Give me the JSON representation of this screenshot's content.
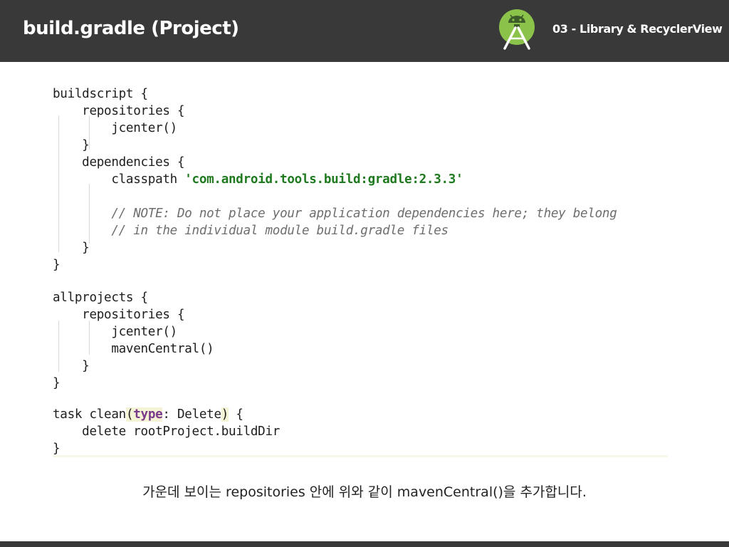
{
  "header": {
    "title": "build.gradle (Project)",
    "subtitle": "03 - Library & RecyclerView",
    "background_color": "#393939",
    "logo_icon": "android-studio-icon"
  },
  "code": {
    "lines": [
      "buildscript {",
      "    repositories {",
      "        jcenter()",
      "    }",
      "    dependencies {",
      "        classpath ",
      "",
      "        // NOTE: Do not place your application dependencies here; they belong",
      "        // in the individual module build.gradle files",
      "    }",
      "}",
      "",
      "allprojects {",
      "    repositories {",
      "        jcenter()",
      "        mavenCentral()",
      "    }",
      "}",
      "",
      "task clean",
      "    delete rootProject.buildDir",
      "}"
    ],
    "classpath_string": "'com.android.tools.build:gradle:2.3.3'",
    "task_open_paren": "(",
    "task_keyword": "type",
    "task_rest": ": Delete",
    "task_close_paren": ")",
    "task_brace": " {",
    "colors": {
      "string": "#1f7a1f",
      "comment": "#6e6e6e",
      "keyword": "#7a3a8a",
      "text": "#1e1e1e"
    }
  },
  "caption": {
    "text": "가운데 보이는 repositories 안에 위와 같이 mavenCentral()을 추가합니다."
  },
  "footer": {
    "background_color": "#393939"
  }
}
